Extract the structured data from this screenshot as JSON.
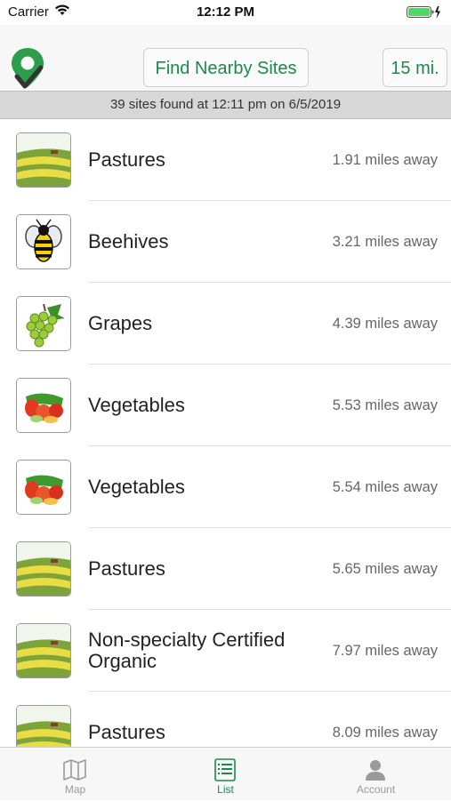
{
  "status_bar": {
    "carrier": "Carrier",
    "time": "12:12 PM"
  },
  "header": {
    "find_button": "Find Nearby Sites",
    "radius_button": "15 mi."
  },
  "summary": "39 sites found at 12:11 pm on 6/5/2019",
  "sites": [
    {
      "name": "Pastures",
      "distance": "1.91 miles away",
      "icon": "pasture-icon"
    },
    {
      "name": "Beehives",
      "distance": "3.21 miles away",
      "icon": "bee-icon"
    },
    {
      "name": "Grapes",
      "distance": "4.39 miles away",
      "icon": "grapes-icon"
    },
    {
      "name": "Vegetables",
      "distance": "5.53 miles away",
      "icon": "vegetables-icon"
    },
    {
      "name": "Vegetables",
      "distance": "5.54 miles away",
      "icon": "vegetables-icon"
    },
    {
      "name": "Pastures",
      "distance": "5.65 miles away",
      "icon": "pasture-icon"
    },
    {
      "name": "Non-specialty Certified Organic",
      "distance": "7.97 miles away",
      "icon": "pasture-icon"
    },
    {
      "name": "Pastures",
      "distance": "8.09 miles away",
      "icon": "pasture-icon"
    }
  ],
  "tabs": [
    {
      "label": "Map",
      "icon": "map-icon",
      "active": false
    },
    {
      "label": "List",
      "icon": "list-icon",
      "active": true
    },
    {
      "label": "Account",
      "icon": "account-icon",
      "active": false
    }
  ],
  "colors": {
    "accent": "#1a8a4a",
    "summary_bg": "#d7d7d7",
    "battery": "#4cd964"
  }
}
